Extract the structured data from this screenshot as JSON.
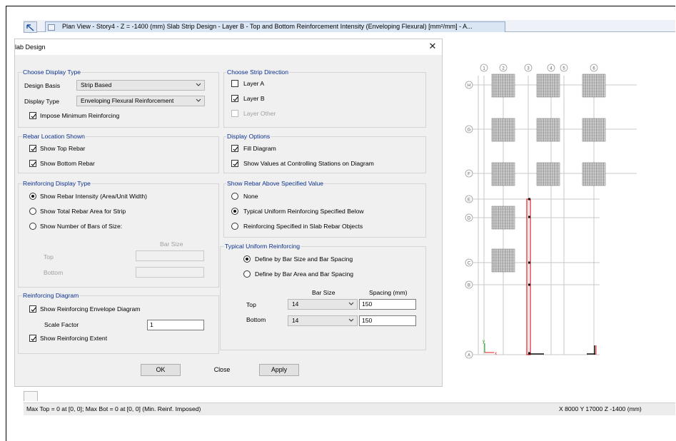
{
  "window": {
    "tab_title": "Plan View - Story4 - Z = -1400 (mm)  Slab Strip Design - Layer B - Top and Bottom Reinforcement Intensity (Enveloping Flexural) [mm²/mm] - A..."
  },
  "dialog": {
    "title": "lab Design",
    "close_glyph": "✕",
    "display_type": {
      "label": "Choose Display Type",
      "design_basis_label": "Design Basis",
      "design_basis_value": "Strip Based",
      "display_type_label": "Display Type",
      "display_type_value": "Enveloping Flexural Reinforcement",
      "impose_min_label": "Impose Minimum Reinforcing"
    },
    "strip_direction": {
      "label": "Choose Strip Direction",
      "layer_a": "Layer A",
      "layer_b": "Layer B",
      "layer_other": "Layer Other"
    },
    "rebar_location": {
      "label": "Rebar Location Shown",
      "show_top": "Show Top Rebar",
      "show_bottom": "Show Bottom Rebar"
    },
    "display_options": {
      "label": "Display Options",
      "fill_diagram": "Fill Diagram",
      "show_values": "Show Values at Controlling Stations on Diagram"
    },
    "reinforcing_display": {
      "label": "Reinforcing Display Type",
      "opt_intensity": "Show Rebar Intensity (Area/Unit Width)",
      "opt_total": "Show Total Rebar Area for Strip",
      "opt_bars": "Show Number of Bars of Size:",
      "bar_size_header": "Bar Size",
      "top_label": "Top",
      "bottom_label": "Bottom"
    },
    "rebar_above": {
      "label": "Show Rebar Above Specified Value",
      "opt_none": "None",
      "opt_typical": "Typical Uniform Reinforcing Specified Below",
      "opt_slab": "Reinforcing Specified in Slab Rebar Objects"
    },
    "typical_uniform": {
      "label": "Typical Uniform Reinforcing",
      "opt_size": "Define by Bar Size and Bar Spacing",
      "opt_area": "Define by Bar Area and Bar Spacing",
      "bar_size_header": "Bar Size",
      "spacing_header": "Spacing  (mm)",
      "top_label": "Top",
      "top_size": "14",
      "top_spacing": "150",
      "bottom_label": "Bottom",
      "bottom_size": "14",
      "bottom_spacing": "150"
    },
    "reinforcing_diagram": {
      "label": "Reinforcing Diagram",
      "show_envelope": "Show Reinforcing Envelope Diagram",
      "scale_factor_label": "Scale Factor",
      "scale_factor_value": "1",
      "show_extent": "Show Reinforcing Extent"
    },
    "buttons": {
      "ok": "OK",
      "close": "Close",
      "apply": "Apply"
    }
  },
  "status": {
    "left": "Max Top = 0 at [0, 0];  Max Bot = 0 at [0, 0]  (Min. Reinf. Imposed)",
    "right": "X 8000  Y 17000  Z -1400 (mm)"
  },
  "plan": {
    "grid_x": [
      "1",
      "2",
      "3",
      "4",
      "5",
      "6"
    ],
    "grid_y": [
      "H",
      "G",
      "F",
      "E",
      "D",
      "C",
      "B",
      "A"
    ],
    "axis_x": "x",
    "axis_y": "y",
    "line_color": "#c8c8c8",
    "strip_color": "#e0202a",
    "hatch_color": "#6a6a6a"
  },
  "colors": {
    "group_title": "#0a2f8c",
    "dialog_bg": "#f0f0f0",
    "tab_bg": "#dbe6f5"
  }
}
